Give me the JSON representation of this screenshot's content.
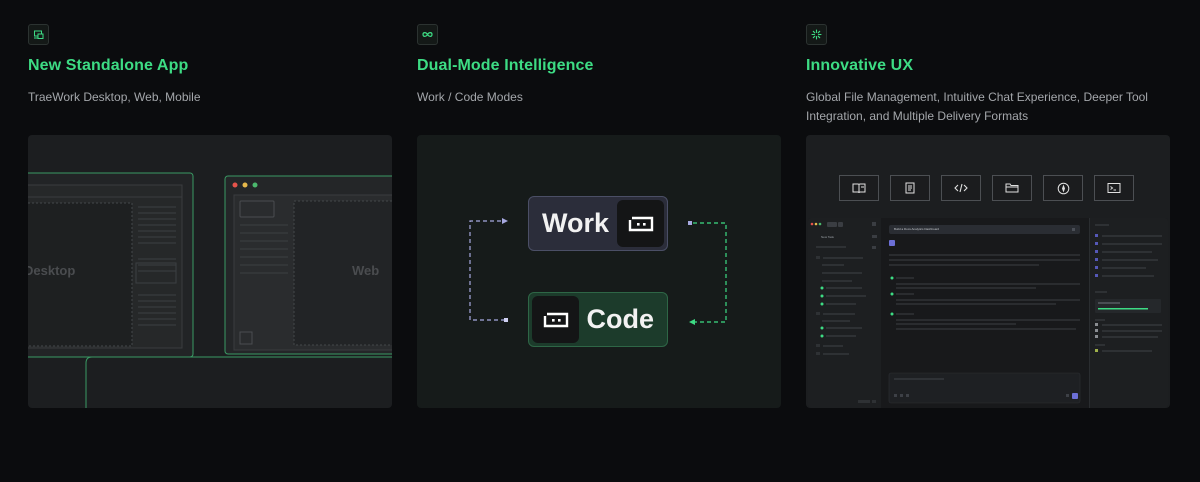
{
  "features": [
    {
      "icon": "desktop-app-icon",
      "title": "New Standalone App",
      "description": "TraeWork Desktop, Web, Mobile",
      "visual": {
        "desktop_label": "Desktop",
        "web_label": "Web"
      }
    },
    {
      "icon": "infinity-icon",
      "title": "Dual-Mode Intelligence",
      "description": "Work / Code Modes",
      "visual": {
        "work_label": "Work",
        "code_label": "Code"
      }
    },
    {
      "icon": "sparkle-icon",
      "title": "Innovative UX",
      "description": "Global File Management, Intuitive Chat Experience, Deeper Tool Integration, and Multiple Delivery Formats",
      "visual": {
        "tool_icons": [
          "book-icon",
          "document-icon",
          "code-icon",
          "folder-icon",
          "compass-icon",
          "terminal-icon"
        ],
        "mini_app": {
          "new_task": "New Task",
          "prompt": "Build a Docs Analytics Dashboard"
        }
      }
    }
  ],
  "colors": {
    "accent": "#3ddc84",
    "background": "#0b0c0e",
    "card": "#1c1e20",
    "work_mode": "#2b2d3a",
    "code_mode": "#1c3b2b"
  }
}
